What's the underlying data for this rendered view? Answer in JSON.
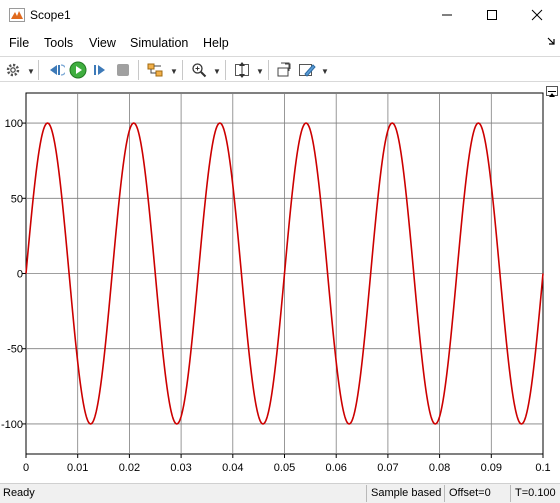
{
  "window": {
    "title": "Scope1"
  },
  "menu": {
    "items": [
      "File",
      "Tools",
      "View",
      "Simulation",
      "Help"
    ]
  },
  "toolbar": {
    "buttons": [
      "settings-icon",
      "step-back-icon",
      "run-icon",
      "step-forward-icon",
      "stop-icon",
      "signal-selector-icon",
      "zoom-in-icon",
      "autoscale-icon",
      "restore-view-icon",
      "style-icon"
    ]
  },
  "colors": {
    "signal": "#cc0000",
    "grid": "#7f7f7f",
    "axes": "#000000"
  },
  "chart_data": {
    "type": "line",
    "title": "",
    "xlabel": "",
    "ylabel": "",
    "xlim": [
      0,
      0.1
    ],
    "ylim": [
      -120,
      120
    ],
    "xticks": [
      "0",
      "0.01",
      "0.02",
      "0.03",
      "0.04",
      "0.05",
      "0.06",
      "0.07",
      "0.08",
      "0.09",
      "0.1"
    ],
    "yticks": [
      "100",
      "50",
      "0",
      "-50",
      "-100"
    ],
    "grid": true,
    "series": [
      {
        "function": "100*sin(2*pi*60*t)",
        "amplitude": 100,
        "frequency_hz": 60,
        "color": "#cc0000"
      }
    ]
  },
  "status": {
    "ready": "Ready",
    "sample": "Sample based",
    "offset": "Offset=0",
    "time": "T=0.100"
  }
}
